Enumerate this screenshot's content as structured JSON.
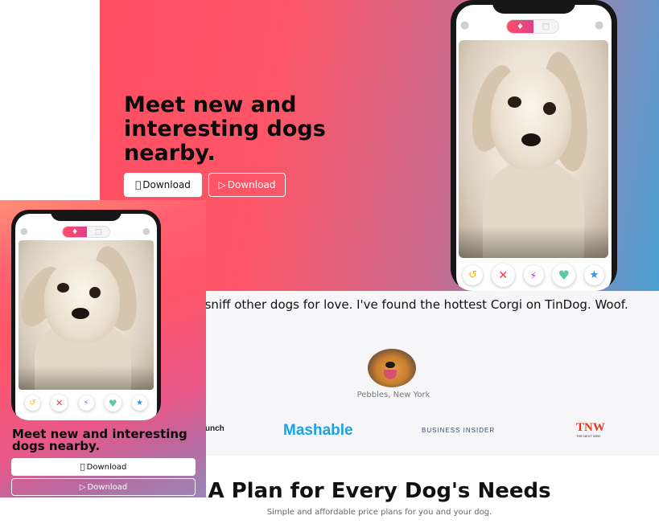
{
  "hero": {
    "title": "Meet new and interesting dogs nearby.",
    "download_apple": "Download",
    "download_play": "Download"
  },
  "icons": {
    "apple": "",
    "play": "▷",
    "undo": "↺",
    "nope": "✕",
    "boost": "⚡",
    "like": "♥",
    "super_like": "★",
    "profile": "●",
    "chat": "●",
    "flame": "♦",
    "book": "□"
  },
  "testimonial": {
    "quote": "r have to sniff other dogs for love. I've found the hottest Corgi on TinDog. Woof.",
    "author": "Pebbles, New York"
  },
  "press": {
    "techcrunch": "runch",
    "mashable": "Mashable",
    "business_insider": "BUSINESS INSIDER",
    "tnw": "TNW",
    "tnw_sub": "THE NEXT WEB"
  },
  "pricing": {
    "title": "A Plan for Every Dog's Needs",
    "subtitle": "Simple and affordable price plans for you and your dog."
  },
  "mobile": {
    "title": "Meet new and interesting dogs nearby.",
    "download_apple": "Download",
    "download_play": "Download"
  },
  "colors": {
    "brand_red": "#ff4f62",
    "brand_blue": "#4a9fd3",
    "mashable_blue": "#19a3e6",
    "tnw_red": "#e8341c",
    "undo_yellow": "#f5b622",
    "nope_red": "#e6394a",
    "boost_purple": "#8b3bd8",
    "like_green": "#5fcaa0",
    "super_blue": "#3a8fe0"
  }
}
